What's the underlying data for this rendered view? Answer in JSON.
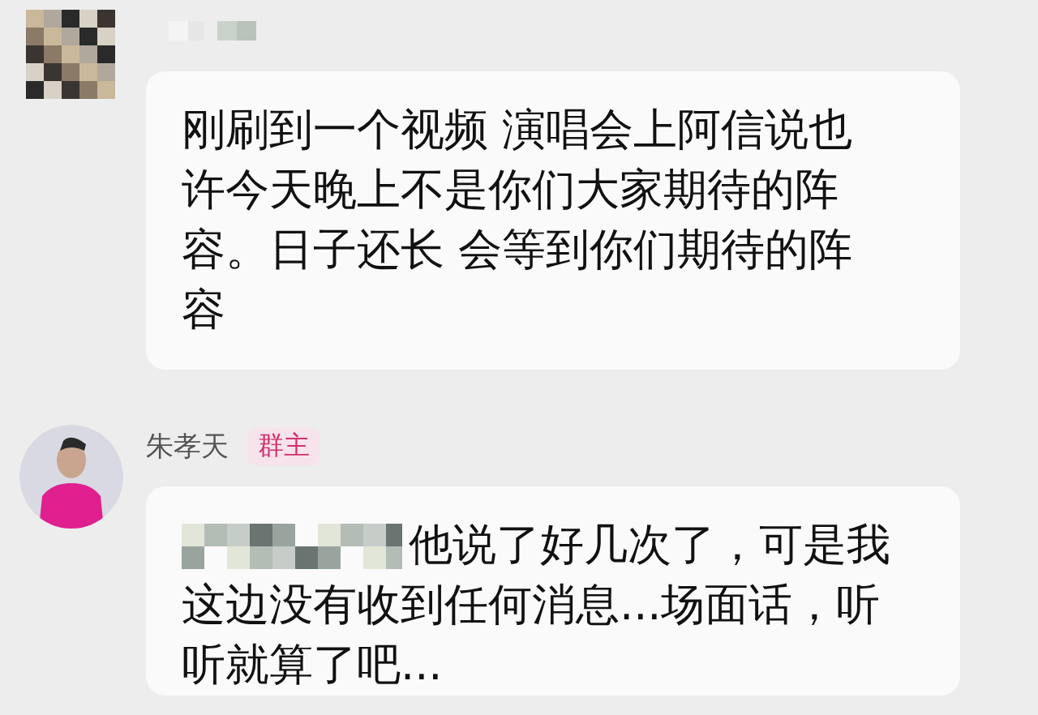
{
  "messages": [
    {
      "kind": "anonymous",
      "texts": [
        "刚刷到一个视频 演唱会上阿信说也许今天晚上不是你们大家期待的阵容。日子还长 会等到你们期待的阵容"
      ]
    },
    {
      "kind": "owner",
      "sender": {
        "name": "朱孝天",
        "badge": "群主"
      },
      "texts": [
        "他说了好几次了，可是我",
        "这边没有收到任何消息...场面话，听听就算了吧..."
      ]
    }
  ]
}
